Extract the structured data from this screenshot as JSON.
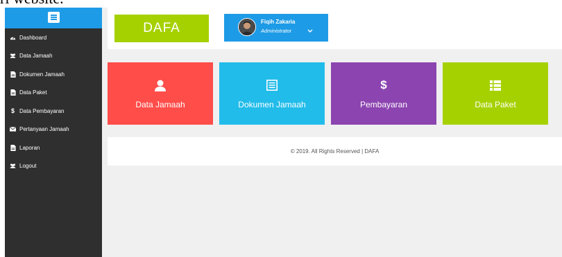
{
  "caption": "ri website.",
  "sidebar": {
    "menu_icon": "hamburger-icon",
    "items": [
      {
        "label": "Dashboard",
        "icon": "tachometer-icon"
      },
      {
        "label": "Data Jamaah",
        "icon": "users-icon"
      },
      {
        "label": "Dokumen Jamaah",
        "icon": "file-icon"
      },
      {
        "label": "Data Paket",
        "icon": "file-icon"
      },
      {
        "label": "Data Pembayaran",
        "icon": "dollar-icon"
      },
      {
        "label": "Pertanyaan Jamaah",
        "icon": "envelope-icon"
      },
      {
        "label": "Laporan",
        "icon": "file-icon"
      },
      {
        "label": "Logout",
        "icon": "users-icon"
      }
    ]
  },
  "header": {
    "brand": "DAFA",
    "user": {
      "name": "Fiqih Zakaria",
      "role": "Administrator"
    }
  },
  "tiles": [
    {
      "label": "Data Jamaah",
      "icon": "user-icon",
      "color": "#ff4d4a"
    },
    {
      "label": "Dokumen Jamaah",
      "icon": "list-alt-icon",
      "color": "#22bcea"
    },
    {
      "label": "Pembayaran",
      "icon": "dollar-icon",
      "color": "#8c44b0",
      "icon_text": "$"
    },
    {
      "label": "Data Paket",
      "icon": "list-icon",
      "color": "#a6d100"
    }
  ],
  "footer": {
    "text": "© 2019. All Rights Reserved | DAFA"
  },
  "colors": {
    "sidebar_bg": "#2f2f2f",
    "accent_blue": "#1e9be6",
    "brand_green": "#a6d100",
    "content_bg": "#f0f0f0"
  }
}
